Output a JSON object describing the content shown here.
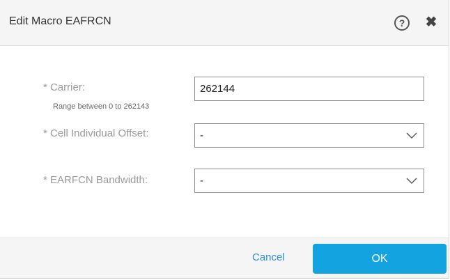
{
  "dialog": {
    "title": "Edit Macro EAFRCN",
    "help_icon": "help-circle-icon",
    "help_glyph": "?",
    "close_icon": "close-icon",
    "close_glyph": "✖"
  },
  "form": {
    "carrier": {
      "label": "* Carrier:",
      "hint": "Range between 0 to 262143",
      "value": "262144"
    },
    "cell_individual_offset": {
      "label": "* Cell Individual Offset:",
      "selected": "-"
    },
    "earfcn_bandwidth": {
      "label": "* EARFCN Bandwidth:",
      "selected": "-"
    }
  },
  "footer": {
    "cancel_label": "Cancel",
    "ok_label": "OK"
  },
  "colors": {
    "header_bg": "#f5f5f5",
    "label_text": "#9a9a9a",
    "link_blue": "#2a8fd0",
    "ok_button_bg": "#12a3e0"
  }
}
